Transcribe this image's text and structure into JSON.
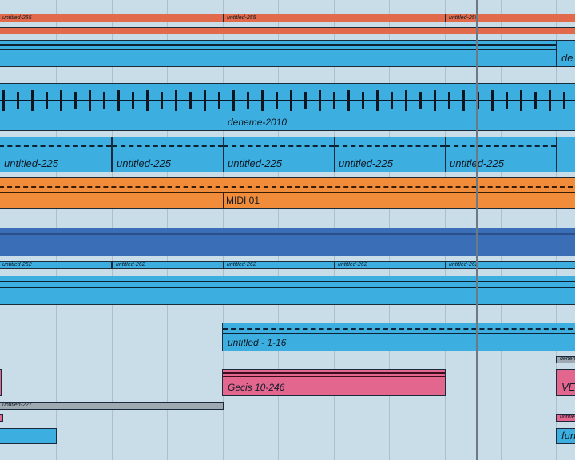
{
  "arrangement": {
    "clips": {
      "red_top": [
        "untitled-255",
        "untitled-255",
        "untitled-255"
      ],
      "deneme": "deneme-2010",
      "de_tail": "de",
      "untitled225": [
        "untitled-225",
        "untitled-225",
        "untitled-225",
        "untitled-225",
        "untitled-225"
      ],
      "midi": "MIDI 01",
      "thin_blue": [
        "untitled-262",
        "untitled-262",
        "untitled-262",
        "untitled-262",
        "untitled-262"
      ],
      "untitled116": "untitled - 1-16",
      "gecis": "Gecis 10-246",
      "ve_tail": "VE",
      "gray_small": "untitled-227",
      "fun_tail": "fun",
      "small_right_top": "deneme",
      "small_right_pink": "untitle"
    }
  }
}
